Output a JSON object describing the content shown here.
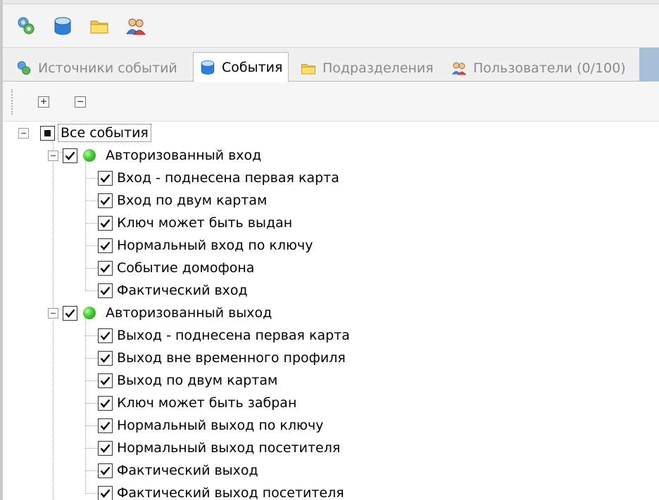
{
  "toolbar": {
    "buttons": [
      {
        "icon": "event-sources-icon"
      },
      {
        "icon": "events-db-icon"
      },
      {
        "icon": "folder-icon"
      },
      {
        "icon": "users-icon"
      }
    ]
  },
  "tabs": [
    {
      "label": "Источники событий",
      "icon": "event-sources-icon",
      "active": false
    },
    {
      "label": "События",
      "icon": "events-db-icon",
      "active": true
    },
    {
      "label": "Подразделения",
      "icon": "folder-icon",
      "active": false
    },
    {
      "label": "Пользователи (0/100)",
      "icon": "users-icon",
      "active": false
    }
  ],
  "subtoolbar": {
    "expand_all": "+",
    "collapse_all": "−"
  },
  "tree": {
    "root": {
      "label": "Все события",
      "state": "partial"
    },
    "groups": [
      {
        "label": "Авторизованный вход",
        "checked": true,
        "items": [
          "Вход - поднесена первая карта",
          "Вход по двум картам",
          "Ключ может быть выдан",
          "Нормальный вход по ключу",
          "Событие домофона",
          "Фактический вход"
        ]
      },
      {
        "label": "Авторизованный выход",
        "checked": true,
        "items": [
          "Выход - поднесена первая карта",
          "Выход вне временного профиля",
          "Выход по двум картам",
          "Ключ может быть забран",
          "Нормальный выход по ключу",
          "Нормальный выход посетителя",
          "Фактический выход",
          "Фактический выход посетителя"
        ]
      }
    ]
  },
  "colors": {
    "status_green": "#3fce2c",
    "tab_accent": "#a8bfd8",
    "folder_yellow": "#f3c942",
    "db_blue": "#2f7fd6"
  }
}
